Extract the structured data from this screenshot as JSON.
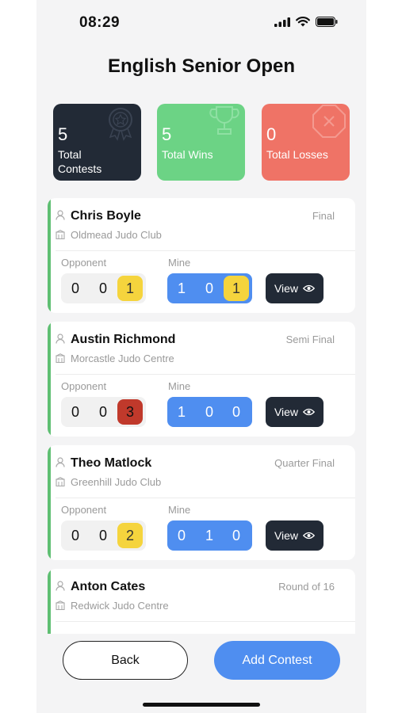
{
  "status_bar": {
    "time": "08:29"
  },
  "page": {
    "title": "English Senior Open"
  },
  "stats": [
    {
      "value": "5",
      "label": "Total Contests",
      "color": "#222a36",
      "icon": "medal-icon"
    },
    {
      "value": "5",
      "label": "Total Wins",
      "color": "#6cd385",
      "icon": "trophy-icon"
    },
    {
      "value": "0",
      "label": "Total Losses",
      "color": "#ef7366",
      "icon": "x-octagon-icon"
    }
  ],
  "labels": {
    "opponent": "Opponent",
    "mine": "Mine",
    "view": "View"
  },
  "contests": [
    {
      "name": "Chris Boyle",
      "round": "Final",
      "club": "Oldmead Judo Club",
      "opponent": [
        "0",
        "0",
        "1"
      ],
      "mine": [
        "1",
        "0",
        "1"
      ],
      "opponent_highlight": "yellow",
      "mine_highlight": "yellow"
    },
    {
      "name": "Austin Richmond",
      "round": "Semi Final",
      "club": "Morcastle Judo Centre",
      "opponent": [
        "0",
        "0",
        "3"
      ],
      "mine": [
        "1",
        "0",
        "0"
      ],
      "opponent_highlight": "red",
      "mine_highlight": ""
    },
    {
      "name": "Theo Matlock",
      "round": "Quarter Final",
      "club": "Greenhill Judo Club",
      "opponent": [
        "0",
        "0",
        "2"
      ],
      "mine": [
        "0",
        "1",
        "0"
      ],
      "opponent_highlight": "yellow",
      "mine_highlight": ""
    },
    {
      "name": "Anton Cates",
      "round": "Round of 16",
      "club": "Redwick Judo Centre",
      "opponent": [
        "",
        "",
        ""
      ],
      "mine": [
        "",
        "",
        ""
      ],
      "opponent_highlight": "",
      "mine_highlight": ""
    }
  ],
  "footer": {
    "back_label": "Back",
    "add_label": "Add Contest"
  },
  "colors": {
    "accent_blue": "#4f8ef0",
    "dark": "#222a36",
    "win_green": "#5fbf73"
  }
}
